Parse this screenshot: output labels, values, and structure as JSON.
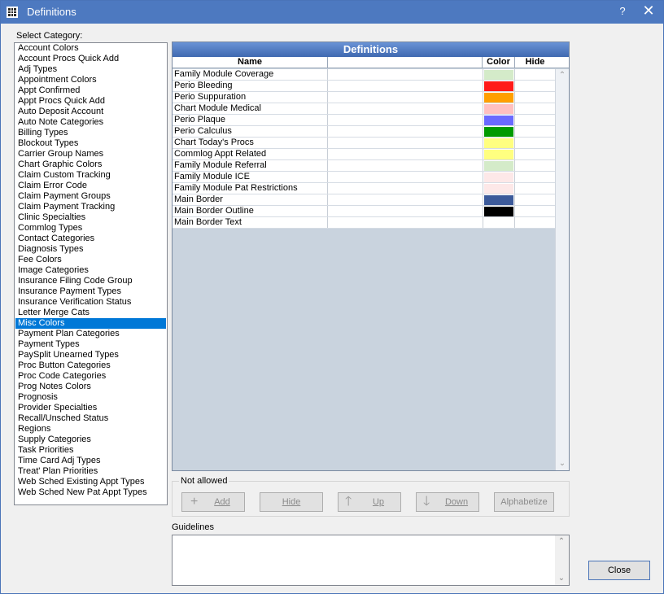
{
  "window": {
    "title": "Definitions",
    "help_label": "?",
    "close_glyph": "✕"
  },
  "category": {
    "label": "Select Category:",
    "selected_index": 26,
    "items": [
      "Account Colors",
      "Account Procs Quick Add",
      "Adj Types",
      "Appointment Colors",
      "Appt Confirmed",
      "Appt Procs Quick Add",
      "Auto Deposit Account",
      "Auto Note Categories",
      "Billing Types",
      "Blockout Types",
      "Carrier Group Names",
      "Chart Graphic Colors",
      "Claim Custom Tracking",
      "Claim Error Code",
      "Claim Payment Groups",
      "Claim Payment Tracking",
      "Clinic Specialties",
      "Commlog Types",
      "Contact Categories",
      "Diagnosis Types",
      "Fee Colors",
      "Image Categories",
      "Insurance Filing Code Group",
      "Insurance Payment Types",
      "Insurance Verification Status",
      "Letter Merge Cats",
      "Misc Colors",
      "Payment Plan Categories",
      "Payment Types",
      "PaySplit Unearned Types",
      "Proc Button Categories",
      "Proc Code Categories",
      "Prog Notes Colors",
      "Prognosis",
      "Provider Specialties",
      "Recall/Unsched Status",
      "Regions",
      "Supply Categories",
      "Task Priorities",
      "Time Card Adj Types",
      "Treat' Plan Priorities",
      "Web Sched Existing Appt Types",
      "Web Sched New Pat Appt Types"
    ]
  },
  "grid": {
    "title": "Definitions",
    "columns": {
      "name": "Name",
      "value": "",
      "color": "Color",
      "hide": "Hide"
    },
    "rows": [
      {
        "name": "Family Module Coverage",
        "color": "#d4ebc9"
      },
      {
        "name": "Perio Bleeding",
        "color": "#ff1a1a"
      },
      {
        "name": "Perio Suppuration",
        "color": "#ff9f00"
      },
      {
        "name": "Chart Module Medical",
        "color": "#ffc0c0"
      },
      {
        "name": "Perio Plaque",
        "color": "#6a6aff"
      },
      {
        "name": "Perio Calculus",
        "color": "#009a00"
      },
      {
        "name": "Chart Today's Procs",
        "color": "#ffff80"
      },
      {
        "name": "Commlog Appt Related",
        "color": "#ffff80"
      },
      {
        "name": "Family Module Referral",
        "color": "#d4ebc9"
      },
      {
        "name": "Family Module ICE",
        "color": "#fde8e8"
      },
      {
        "name": "Family Module Pat Restrictions",
        "color": "#fde8e8"
      },
      {
        "name": "Main Border",
        "color": "#3c5a9a"
      },
      {
        "name": "Main Border Outline",
        "color": "#000000"
      },
      {
        "name": "Main Border Text",
        "color": "#ffffff"
      }
    ]
  },
  "actions": {
    "group_label": "Not allowed",
    "add": "Add",
    "hide": "Hide",
    "up": "Up",
    "down": "Down",
    "alphabetize": "Alphabetize"
  },
  "guidelines": {
    "label": "Guidelines",
    "value": ""
  },
  "close_label": "Close"
}
